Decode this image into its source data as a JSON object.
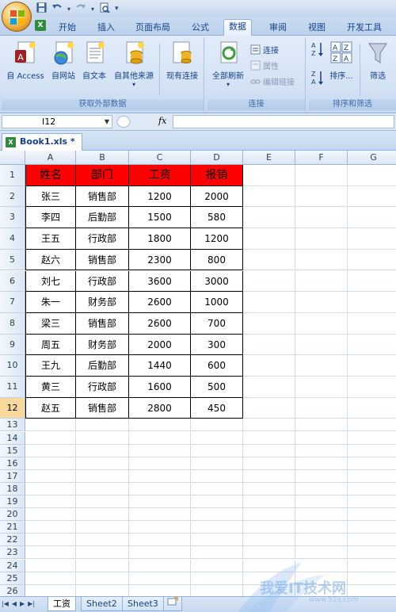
{
  "quick_access": {
    "dropdown_glyph": "▾"
  },
  "ribbon_tabs": [
    "开始",
    "插入",
    "页面布局",
    "公式",
    "数据",
    "审阅",
    "视图",
    "开发工具"
  ],
  "active_tab": "数据",
  "groups": {
    "external": {
      "label": "获取外部数据",
      "buttons": [
        "自 Access",
        "自网站",
        "自文本",
        "自其他来源",
        "现有连接"
      ]
    },
    "connections": {
      "label": "连接",
      "refresh": "全部刷新",
      "connect": "连接",
      "properties": "属性",
      "edit_links": "编辑链接"
    },
    "sort": {
      "label": "排序和筛选",
      "sort": "排序...",
      "filter": "筛选"
    }
  },
  "formula_bar": {
    "name_box": "I12",
    "fx": "fx",
    "formula": ""
  },
  "workbook_tab": "Book1.xls *",
  "columns": [
    "A",
    "B",
    "C",
    "D",
    "E",
    "F",
    "G"
  ],
  "table": {
    "headers": [
      "姓名",
      "部门",
      "工资",
      "报销"
    ],
    "rows": [
      [
        "张三",
        "销售部",
        "1200",
        "2000"
      ],
      [
        "李四",
        "后勤部",
        "1500",
        "580"
      ],
      [
        "王五",
        "行政部",
        "1800",
        "1200"
      ],
      [
        "赵六",
        "销售部",
        "2300",
        "800"
      ],
      [
        "刘七",
        "行政部",
        "3600",
        "3000"
      ],
      [
        "朱一",
        "财务部",
        "2600",
        "1000"
      ],
      [
        "梁三",
        "销售部",
        "2600",
        "700"
      ],
      [
        "周五",
        "财务部",
        "2000",
        "300"
      ],
      [
        "王九",
        "后勤部",
        "1440",
        "600"
      ],
      [
        "黄三",
        "行政部",
        "1600",
        "500"
      ],
      [
        "赵五",
        "销售部",
        "2800",
        "450"
      ]
    ]
  },
  "row_numbers": [
    "1",
    "2",
    "3",
    "4",
    "5",
    "6",
    "7",
    "8",
    "9",
    "10",
    "11",
    "12",
    "13",
    "14",
    "15",
    "16",
    "17",
    "18",
    "19",
    "20",
    "21",
    "22",
    "23",
    "24",
    "25",
    "26"
  ],
  "selected_row": "12",
  "sheet_tabs": [
    "工资",
    "Sheet2",
    "Sheet3"
  ],
  "active_sheet": "工资",
  "watermark": {
    "text": "我爱IT技术网",
    "sub": "www.52ij.com"
  },
  "colors": {
    "header_fill": "#ff0000",
    "selected_row": "#f9d99b",
    "ribbon": "#d2e1f4"
  }
}
